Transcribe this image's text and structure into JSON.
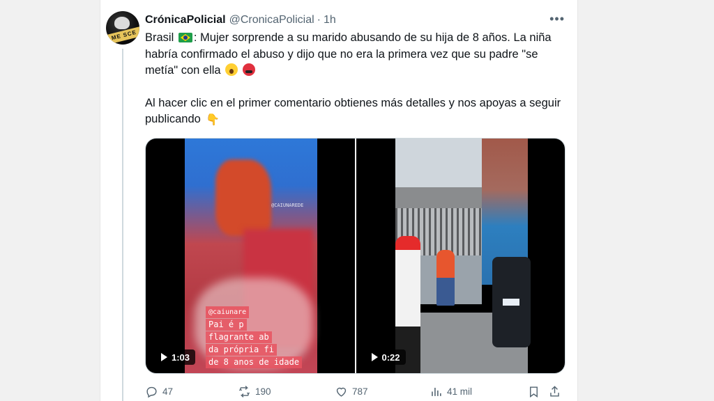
{
  "tweet": {
    "author_name": "CrónicaPolicial",
    "handle": "@CronicaPolicial",
    "separator": "·",
    "time": "1h",
    "more_label": "•••",
    "avatar_text": "ME SCE",
    "line1_pre": "Brasil",
    "line1_post": ": Mujer sorprende a su marido abusando de su hija de 8 años. La niña habría confirmado el abuso y dijo que no era la primera vez que su padre \"se metía\" con ella",
    "paragraph2": "Al hacer clic en el primer comentario obtienes más detalles y nos apoyas a seguir publicando"
  },
  "media": {
    "video1": {
      "duration": "1:03",
      "watermark": "@CAIUNAREDE",
      "caption_handle": "@caiunare",
      "caption_lines": [
        "Pai é p",
        "flagrante ab",
        "da própria fi",
        "de 8 anos de idade"
      ]
    },
    "video2": {
      "duration": "0:22"
    }
  },
  "actions": {
    "replies": "47",
    "reposts": "190",
    "likes": "787",
    "views": "41 mil"
  },
  "colors": {
    "text_primary": "#0f1419",
    "text_secondary": "#536471",
    "background": "#f1f1f1",
    "card": "#ffffff"
  }
}
